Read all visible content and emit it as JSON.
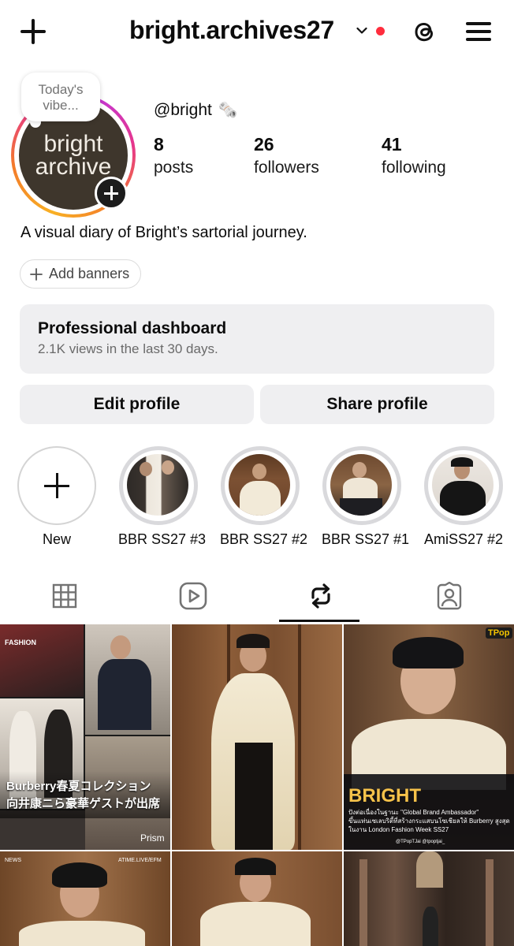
{
  "header": {
    "username": "bright.archives27",
    "icons": [
      "plus-icon",
      "chevron-down-icon",
      "threads-icon",
      "menu-icon"
    ],
    "notification_dot_color": "#ff2d3d"
  },
  "profile": {
    "note_text": "Today's vibe...",
    "avatar_line1": "bright",
    "avatar_line2": "archive",
    "handle": "@bright",
    "handle_emoji": "🗞️",
    "stats": [
      {
        "value": "8",
        "label": "posts"
      },
      {
        "value": "26",
        "label": "followers"
      },
      {
        "value": "41",
        "label": "following"
      }
    ],
    "bio": "A visual diary of Bright’s sartorial journey.",
    "add_banners": "Add banners"
  },
  "dashboard": {
    "title": "Professional dashboard",
    "subtitle": "2.1K views in the last 30 days."
  },
  "buttons": {
    "edit": "Edit profile",
    "share": "Share profile"
  },
  "highlights": [
    {
      "label": "New"
    },
    {
      "label": "BBR SS27 #3"
    },
    {
      "label": "BBR SS27 #2"
    },
    {
      "label": "BBR SS27 #1"
    },
    {
      "label": "AmiSS27 #2"
    }
  ],
  "tabs": [
    "grid-icon",
    "reels-icon",
    "reposts-icon",
    "tagged-icon"
  ],
  "grid": {
    "post1": {
      "tag": "FASHION",
      "caption_line1": "Burberry春夏コレクション",
      "caption_line2": "向井康ニら豪華ゲストが出席",
      "source": "Prism"
    },
    "post3": {
      "brand": "TPop",
      "title": "BRIGHT",
      "line1": "ปังต่อเนื่องในฐานะ \"Global Brand Ambassador\"",
      "line2": "ขึ้นแท่นเซเลบริตี้ที่สร้างกระแสบนโซเชียลให้ Burberry สูงสุด",
      "line3": "ในงาน London Fashion Week SS27",
      "footer": "@TPopTJai  @tpoptjai_"
    },
    "post4": {
      "left": "NEWS",
      "right": "ATIME.LIVE/EFM"
    }
  }
}
